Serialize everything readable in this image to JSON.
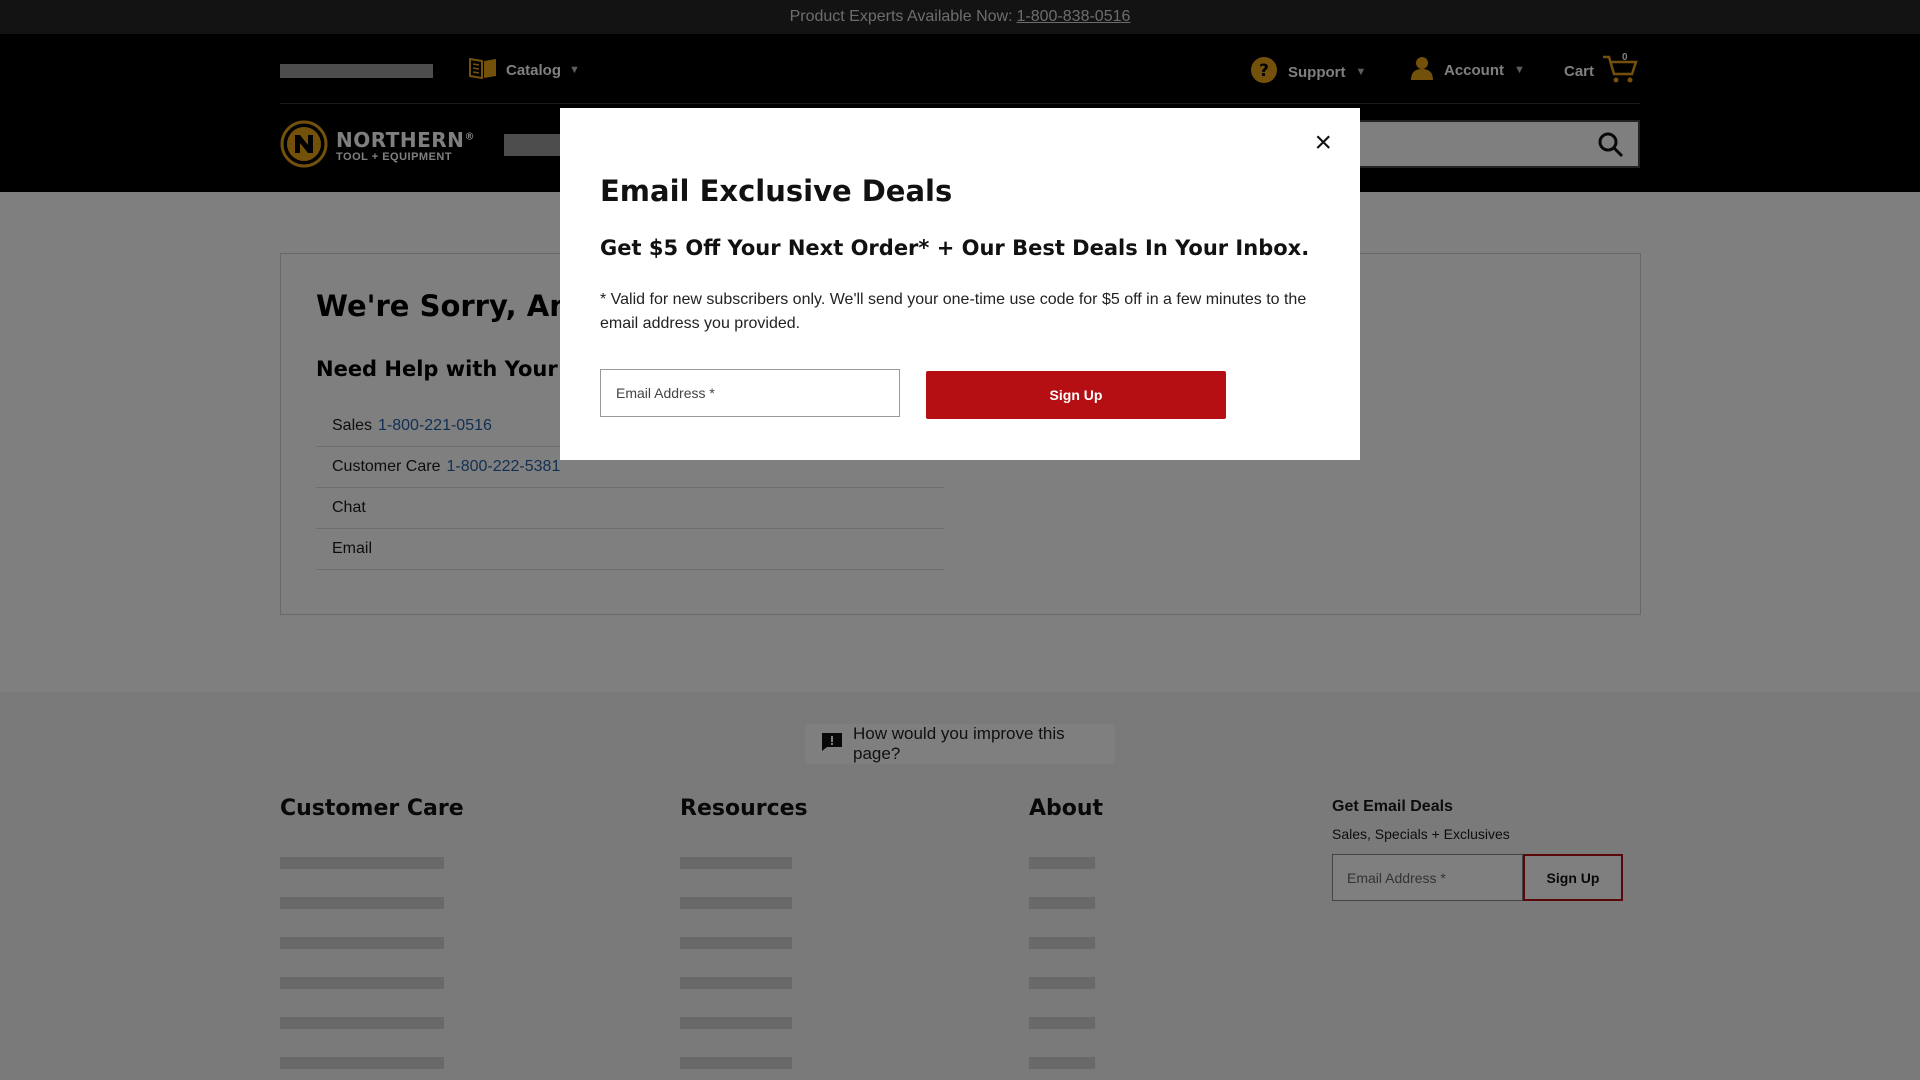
{
  "topbar": {
    "text": "Product Experts Available Now:",
    "phone": "1-800-838-0516"
  },
  "header": {
    "catalog_label": "Catalog",
    "support_label": "Support",
    "account_label": "Account",
    "cart_label": "Cart",
    "cart_count": "0",
    "brand_name": "NORTHERN",
    "brand_registered": "®",
    "brand_sub": "TOOL + EQUIPMENT"
  },
  "error": {
    "title": "We're Sorry, An E",
    "help_title": "Need Help with Your O",
    "rows": [
      {
        "label": "Sales",
        "link": "1-800-221-0516"
      },
      {
        "label": "Customer Care",
        "link": "1-800-222-5381"
      },
      {
        "label": "Chat",
        "link": ""
      },
      {
        "label": "Email",
        "link": ""
      }
    ]
  },
  "footer": {
    "feedback": "How would you improve this page?",
    "columns": [
      "Customer Care",
      "Resources",
      "About"
    ],
    "email_title": "Get Email Deals",
    "email_sub": "Sales, Specials + Exclusives",
    "email_placeholder": "Email Address *",
    "signup_label": "Sign Up"
  },
  "modal": {
    "close": "×",
    "title": "Email Exclusive Deals",
    "subtitle": "Get $5 Off Your Next Order* + Our Best Deals In Your Inbox.",
    "note": "* Valid for new subscribers only. We'll send your one-time use code for $5 off in a few minutes to the email address you provided.",
    "email_placeholder": "Email Address *",
    "signup_label": "Sign Up"
  },
  "colors": {
    "accent": "#b50f14",
    "brand_gold": "#e8a317",
    "link": "#2560a8"
  }
}
